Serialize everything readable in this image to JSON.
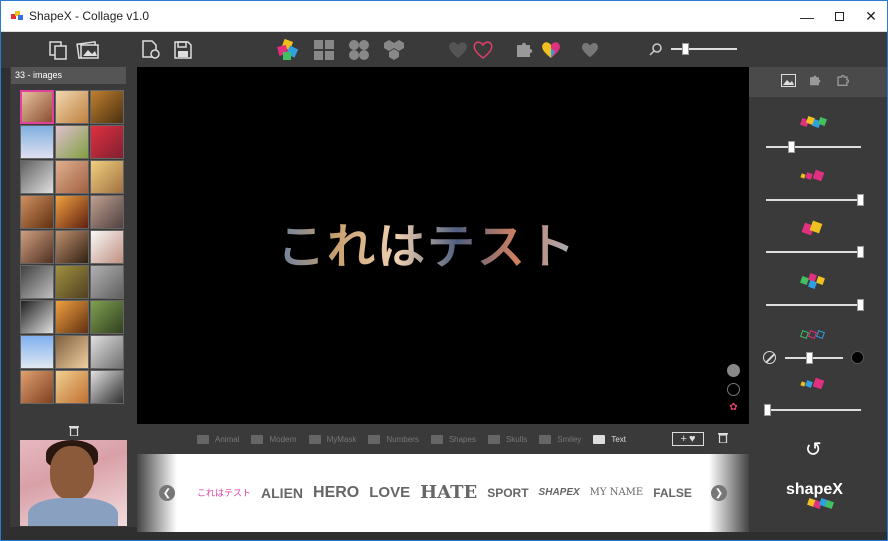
{
  "window": {
    "title": "ShapeX - Collage v1.0",
    "minimize_icon": "minimize-icon",
    "maximize_icon": "maximize-icon",
    "close_icon": "close-icon"
  },
  "sidebar": {
    "count_label": "33 - images"
  },
  "canvas": {
    "text": "これはテスト"
  },
  "categories": [
    "Animal",
    "Modern",
    "MyMask",
    "Numbers",
    "Shapes",
    "Skulls",
    "Smiley",
    "Text"
  ],
  "masks": [
    "これはテスト",
    "ALIEN",
    "HERO",
    "LOVE",
    "HATE",
    "SPORT",
    "SHAPEX",
    "MY NAME",
    "FALSE"
  ],
  "logo": "shapeX",
  "colors": {
    "accent": "#e040a0",
    "titlebar_border": "#2a7bd0"
  }
}
